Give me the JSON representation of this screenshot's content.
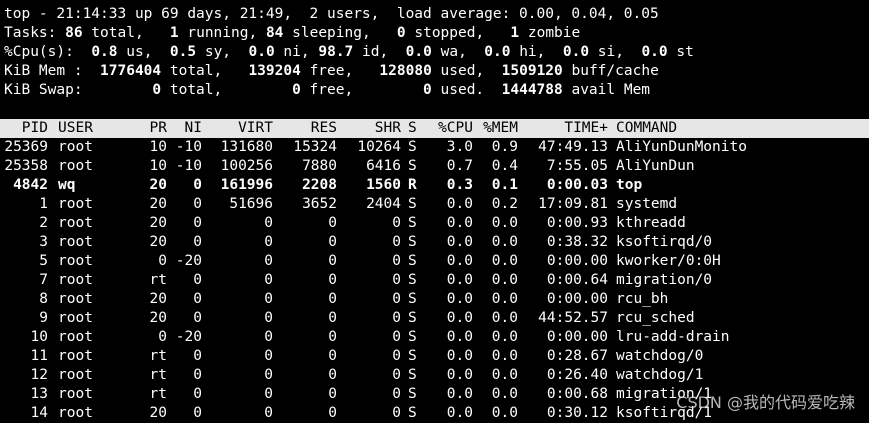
{
  "summary": {
    "uptime": "top - 21:14:33 up 69 days, 21:49,  2 users,  load average: 0.00, 0.04, 0.05",
    "tasks": [
      {
        "t": "Tasks: "
      },
      {
        "t": "86",
        "b": true
      },
      {
        "t": " total,   "
      },
      {
        "t": "1",
        "b": true
      },
      {
        "t": " running, "
      },
      {
        "t": "84",
        "b": true
      },
      {
        "t": " sleeping,   "
      },
      {
        "t": "0",
        "b": true
      },
      {
        "t": " stopped,   "
      },
      {
        "t": "1",
        "b": true
      },
      {
        "t": " zombie"
      }
    ],
    "cpu": [
      {
        "t": "%Cpu(s):  "
      },
      {
        "t": "0.8",
        "b": true
      },
      {
        "t": " us,  "
      },
      {
        "t": "0.5",
        "b": true
      },
      {
        "t": " sy,  "
      },
      {
        "t": "0.0",
        "b": true
      },
      {
        "t": " ni, "
      },
      {
        "t": "98.7",
        "b": true
      },
      {
        "t": " id,  "
      },
      {
        "t": "0.0",
        "b": true
      },
      {
        "t": " wa,  "
      },
      {
        "t": "0.0",
        "b": true
      },
      {
        "t": " hi,  "
      },
      {
        "t": "0.0",
        "b": true
      },
      {
        "t": " si,  "
      },
      {
        "t": "0.0",
        "b": true
      },
      {
        "t": " st"
      }
    ],
    "mem": [
      {
        "t": "KiB Mem :  "
      },
      {
        "t": "1776404",
        "b": true
      },
      {
        "t": " total,   "
      },
      {
        "t": "139204",
        "b": true
      },
      {
        "t": " free,   "
      },
      {
        "t": "128080",
        "b": true
      },
      {
        "t": " used,  "
      },
      {
        "t": "1509120",
        "b": true
      },
      {
        "t": " buff/cache"
      }
    ],
    "swap": [
      {
        "t": "KiB Swap:        "
      },
      {
        "t": "0",
        "b": true
      },
      {
        "t": " total,        "
      },
      {
        "t": "0",
        "b": true
      },
      {
        "t": " free,        "
      },
      {
        "t": "0",
        "b": true
      },
      {
        "t": " used.  "
      },
      {
        "t": "1444788",
        "b": true
      },
      {
        "t": " avail Mem"
      }
    ]
  },
  "columns": {
    "pid": "PID",
    "user": "USER",
    "pr": "PR",
    "ni": "NI",
    "virt": "VIRT",
    "res": "RES",
    "shr": "SHR",
    "s": "S",
    "cpu": "%CPU",
    "mem": "%MEM",
    "time": "TIME+",
    "command": "COMMAND"
  },
  "processes": [
    {
      "pid": "25369",
      "user": "root",
      "pr": "10",
      "ni": "-10",
      "virt": "131680",
      "res": "15324",
      "shr": "10264",
      "s": "S",
      "cpu": "3.0",
      "mem": "0.9",
      "time": "47:49.13",
      "command": "AliYunDunMonito",
      "bold": false
    },
    {
      "pid": "25358",
      "user": "root",
      "pr": "10",
      "ni": "-10",
      "virt": "100256",
      "res": "7880",
      "shr": "6416",
      "s": "S",
      "cpu": "0.7",
      "mem": "0.4",
      "time": "7:55.05",
      "command": "AliYunDun",
      "bold": false
    },
    {
      "pid": "4842",
      "user": "wq",
      "pr": "20",
      "ni": "0",
      "virt": "161996",
      "res": "2208",
      "shr": "1560",
      "s": "R",
      "cpu": "0.3",
      "mem": "0.1",
      "time": "0:00.03",
      "command": "top",
      "bold": true
    },
    {
      "pid": "1",
      "user": "root",
      "pr": "20",
      "ni": "0",
      "virt": "51696",
      "res": "3652",
      "shr": "2404",
      "s": "S",
      "cpu": "0.0",
      "mem": "0.2",
      "time": "17:09.81",
      "command": "systemd",
      "bold": false
    },
    {
      "pid": "2",
      "user": "root",
      "pr": "20",
      "ni": "0",
      "virt": "0",
      "res": "0",
      "shr": "0",
      "s": "S",
      "cpu": "0.0",
      "mem": "0.0",
      "time": "0:00.93",
      "command": "kthreadd",
      "bold": false
    },
    {
      "pid": "3",
      "user": "root",
      "pr": "20",
      "ni": "0",
      "virt": "0",
      "res": "0",
      "shr": "0",
      "s": "S",
      "cpu": "0.0",
      "mem": "0.0",
      "time": "0:38.32",
      "command": "ksoftirqd/0",
      "bold": false
    },
    {
      "pid": "5",
      "user": "root",
      "pr": "0",
      "ni": "-20",
      "virt": "0",
      "res": "0",
      "shr": "0",
      "s": "S",
      "cpu": "0.0",
      "mem": "0.0",
      "time": "0:00.00",
      "command": "kworker/0:0H",
      "bold": false
    },
    {
      "pid": "7",
      "user": "root",
      "pr": "rt",
      "ni": "0",
      "virt": "0",
      "res": "0",
      "shr": "0",
      "s": "S",
      "cpu": "0.0",
      "mem": "0.0",
      "time": "0:00.64",
      "command": "migration/0",
      "bold": false
    },
    {
      "pid": "8",
      "user": "root",
      "pr": "20",
      "ni": "0",
      "virt": "0",
      "res": "0",
      "shr": "0",
      "s": "S",
      "cpu": "0.0",
      "mem": "0.0",
      "time": "0:00.00",
      "command": "rcu_bh",
      "bold": false
    },
    {
      "pid": "9",
      "user": "root",
      "pr": "20",
      "ni": "0",
      "virt": "0",
      "res": "0",
      "shr": "0",
      "s": "S",
      "cpu": "0.0",
      "mem": "0.0",
      "time": "44:52.57",
      "command": "rcu_sched",
      "bold": false
    },
    {
      "pid": "10",
      "user": "root",
      "pr": "0",
      "ni": "-20",
      "virt": "0",
      "res": "0",
      "shr": "0",
      "s": "S",
      "cpu": "0.0",
      "mem": "0.0",
      "time": "0:00.00",
      "command": "lru-add-drain",
      "bold": false
    },
    {
      "pid": "11",
      "user": "root",
      "pr": "rt",
      "ni": "0",
      "virt": "0",
      "res": "0",
      "shr": "0",
      "s": "S",
      "cpu": "0.0",
      "mem": "0.0",
      "time": "0:28.67",
      "command": "watchdog/0",
      "bold": false
    },
    {
      "pid": "12",
      "user": "root",
      "pr": "rt",
      "ni": "0",
      "virt": "0",
      "res": "0",
      "shr": "0",
      "s": "S",
      "cpu": "0.0",
      "mem": "0.0",
      "time": "0:26.40",
      "command": "watchdog/1",
      "bold": false
    },
    {
      "pid": "13",
      "user": "root",
      "pr": "rt",
      "ni": "0",
      "virt": "0",
      "res": "0",
      "shr": "0",
      "s": "S",
      "cpu": "0.0",
      "mem": "0.0",
      "time": "0:00.68",
      "command": "migration/1",
      "bold": false
    },
    {
      "pid": "14",
      "user": "root",
      "pr": "20",
      "ni": "0",
      "virt": "0",
      "res": "0",
      "shr": "0",
      "s": "S",
      "cpu": "0.0",
      "mem": "0.0",
      "time": "0:30.12",
      "command": "ksoftirqd/1",
      "bold": false
    }
  ],
  "watermark": "CSDN @我的代码爱吃辣",
  "colors": {
    "background": "#000000",
    "text": "#ffffff",
    "header_bar": "#e6e6e6",
    "header_text": "#000000"
  }
}
